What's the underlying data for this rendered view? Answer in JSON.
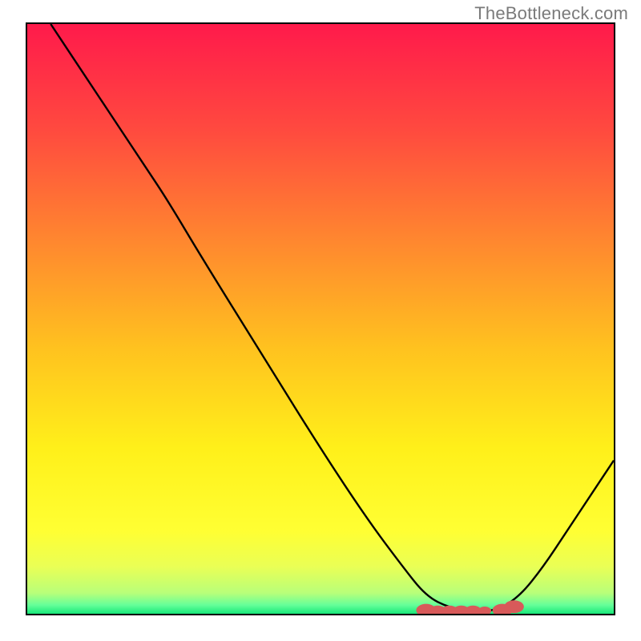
{
  "watermark": "TheBottleneck.com",
  "chart_data": {
    "type": "line",
    "title": "",
    "xlabel": "",
    "ylabel": "",
    "xlim": [
      0,
      100
    ],
    "ylim": [
      0,
      100
    ],
    "gradient_stops": [
      {
        "offset": 0.0,
        "color": "#ff1a4b"
      },
      {
        "offset": 0.18,
        "color": "#ff4a3f"
      },
      {
        "offset": 0.38,
        "color": "#ff8b2e"
      },
      {
        "offset": 0.55,
        "color": "#ffc21f"
      },
      {
        "offset": 0.72,
        "color": "#fff01a"
      },
      {
        "offset": 0.86,
        "color": "#ffff33"
      },
      {
        "offset": 0.92,
        "color": "#eaff55"
      },
      {
        "offset": 0.965,
        "color": "#b8ff7a"
      },
      {
        "offset": 0.985,
        "color": "#66ff99"
      },
      {
        "offset": 1.0,
        "color": "#18e87a"
      }
    ],
    "series": [
      {
        "name": "curve",
        "points": [
          {
            "x": 4,
            "y": 100
          },
          {
            "x": 12,
            "y": 88
          },
          {
            "x": 20,
            "y": 76
          },
          {
            "x": 24,
            "y": 70
          },
          {
            "x": 30,
            "y": 60
          },
          {
            "x": 40,
            "y": 44
          },
          {
            "x": 50,
            "y": 28
          },
          {
            "x": 58,
            "y": 16
          },
          {
            "x": 64,
            "y": 8
          },
          {
            "x": 68,
            "y": 3
          },
          {
            "x": 72,
            "y": 1
          },
          {
            "x": 76,
            "y": 0.5
          },
          {
            "x": 80,
            "y": 0.5
          },
          {
            "x": 84,
            "y": 3
          },
          {
            "x": 88,
            "y": 8
          },
          {
            "x": 92,
            "y": 14
          },
          {
            "x": 96,
            "y": 20
          },
          {
            "x": 100,
            "y": 26
          }
        ]
      }
    ],
    "markers": [
      {
        "x": 68,
        "y": 0.6,
        "r": 1.2,
        "color": "#d85a5a"
      },
      {
        "x": 70,
        "y": 0.5,
        "r": 1.0,
        "color": "#d85a5a"
      },
      {
        "x": 72,
        "y": 0.5,
        "r": 1.0,
        "color": "#d85a5a"
      },
      {
        "x": 74,
        "y": 0.5,
        "r": 1.0,
        "color": "#d85a5a"
      },
      {
        "x": 76,
        "y": 0.5,
        "r": 1.0,
        "color": "#d85a5a"
      },
      {
        "x": 78,
        "y": 0.5,
        "r": 0.8,
        "color": "#d85a5a"
      },
      {
        "x": 81,
        "y": 0.6,
        "r": 1.2,
        "color": "#d85a5a"
      },
      {
        "x": 83,
        "y": 1.2,
        "r": 1.2,
        "color": "#d85a5a"
      }
    ]
  }
}
